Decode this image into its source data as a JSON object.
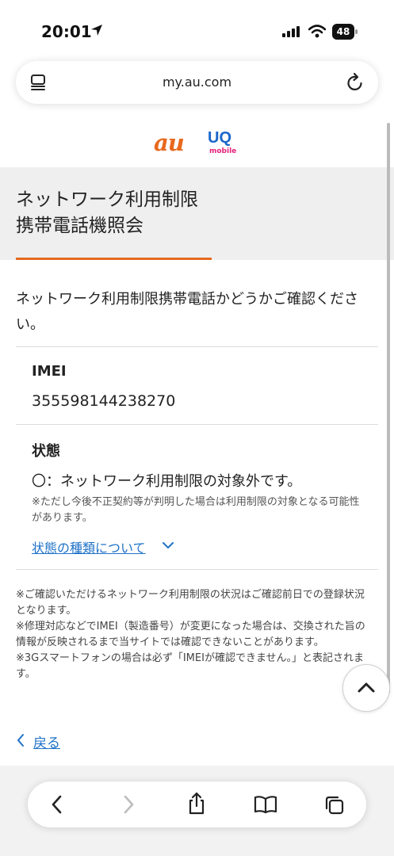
{
  "status_bar": {
    "time": "20:01",
    "battery": "48"
  },
  "browser": {
    "url": "my.au.com"
  },
  "logos": {
    "au": "au",
    "uq": "UQ",
    "uq_sub": "mobile"
  },
  "page": {
    "title_line1": "ネットワーク利用制限",
    "title_line2": "携帯電話機照会",
    "intro": "ネットワーク利用制限携帯電話かどうかご確認ください。",
    "imei_label": "IMEI",
    "imei_value": "355598144238270",
    "status_label": "状態",
    "status_value": "〇：ネットワーク利用制限の対象外です。",
    "status_note": "※ただし今後不正契約等が判明した場合は利用制限の対象となる可能性があります。",
    "types_link": "状態の種類について",
    "notes": [
      "※ご確認いただけるネットワーク利用制限の状況はご確認前日での登録状況となります。",
      "※修理対応などでIMEI（製造番号）が変更になった場合は、交換された旨の情報が反映されるまで当サイトでは確認できないことがあります。",
      "※3Gスマートフォンの場合は必ず「IMEIが確認できません。」と表記されます。"
    ],
    "back_label": "戻る"
  },
  "colors": {
    "accent_orange": "#e8691e",
    "link_blue": "#1f72c8",
    "uq_blue": "#1a66c9",
    "uq_pink": "#e6207a"
  },
  "icons": {
    "status": [
      "location-arrow-icon",
      "signal-icon",
      "wifi-icon",
      "battery-icon"
    ],
    "browser": [
      "tabs-icon",
      "reload-icon"
    ],
    "toolbar": [
      "back-icon",
      "forward-icon",
      "share-icon",
      "bookmarks-icon",
      "tabs-overview-icon"
    ],
    "page": [
      "chevron-down-icon",
      "scroll-top-icon",
      "back-chevron-icon"
    ]
  }
}
